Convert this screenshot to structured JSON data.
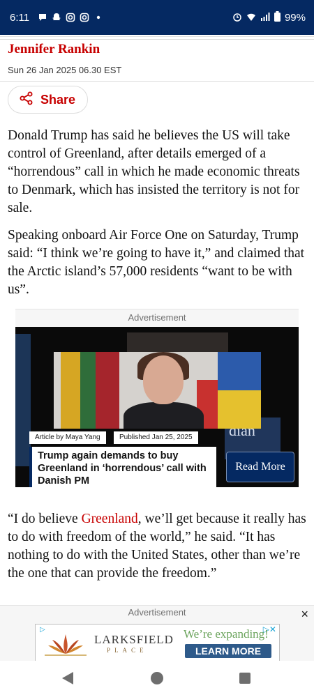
{
  "status_bar": {
    "time": "6:11",
    "battery": "99%",
    "left_icons": [
      "chat-icon",
      "snapchat-icon",
      "instagram-icon",
      "instagram-icon",
      "dot-icon"
    ],
    "right_icons": [
      "alarm-icon",
      "wifi-icon",
      "signal-icon",
      "battery-icon"
    ]
  },
  "article": {
    "author": "Jennifer Rankin",
    "date": "Sun 26 Jan 2025 06.30 EST",
    "share_label": "Share",
    "paragraph1": "Donald Trump has said he believes the US will take control of Greenland, after details emerged of a “horrendous” call in which he made economic threats to Denmark, which has insisted the territory is not for sale.",
    "paragraph2": "Speaking onboard Air Force One on Saturday, Trump said: “I think we’re going to have it,” and claimed that the Arctic island’s 57,000 residents “want to be with us”.",
    "paragraph3_before": "“I do believe ",
    "paragraph3_link": "Greenland",
    "paragraph3_after": ", we’ll get because it really has to do with freedom of the world,” he said. “It has nothing to do with the United States, other than we’re the one that can provide the freedom.”"
  },
  "inline_ad": {
    "label": "Advertisement",
    "tag_author": "Article by Maya Yang",
    "tag_date": "Published Jan 25, 2025",
    "headline": "Trump again demands to buy Greenland in ‘horrendous’ call with Danish PM",
    "cta": "Read More",
    "bg_text": "dian"
  },
  "bottom_ad": {
    "label": "Advertisement",
    "close_icon": "×",
    "brand": "LARKSFIELD",
    "brand_sub": "PLACE",
    "tagline": "We’re expanding!",
    "cta": "LEARN MORE"
  },
  "colors": {
    "guardian_navy": "#052962",
    "guardian_red": "#c70000"
  }
}
